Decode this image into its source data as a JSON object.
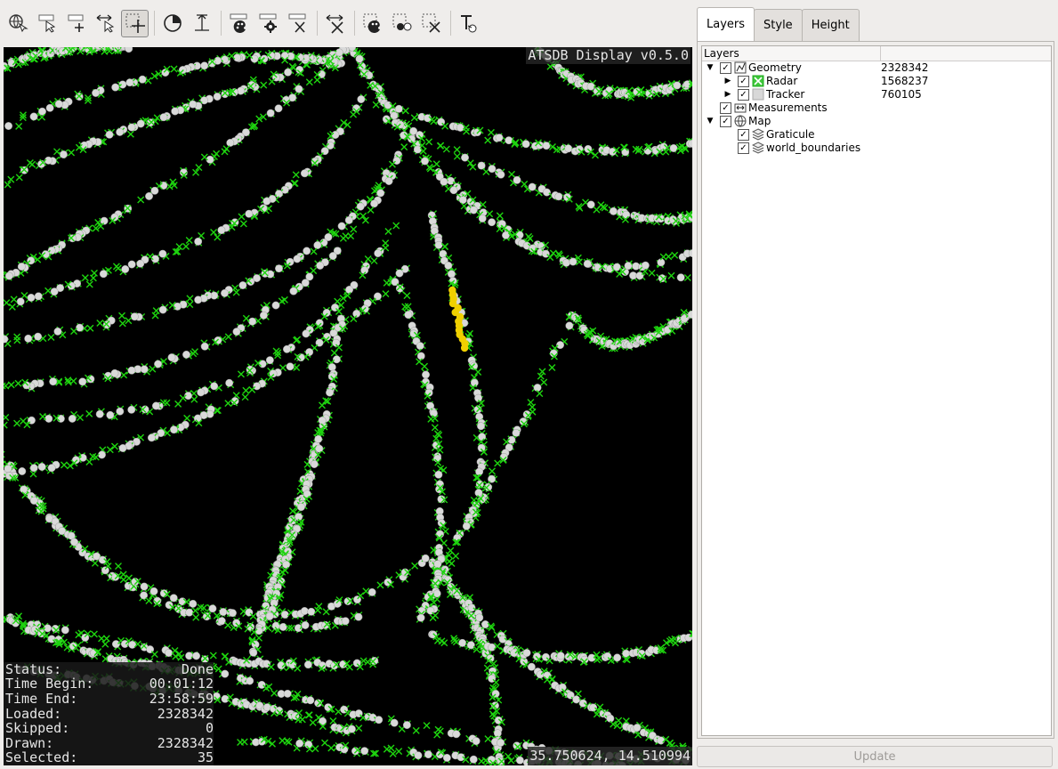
{
  "toolbar": {
    "groups": [
      [
        "globe-hand-icon",
        "select-tool-icon",
        "add-select-icon",
        "navigate-icon",
        "crosshair-select-icon"
      ],
      [
        "time-icon",
        "height-filter-icon"
      ],
      [
        "style-icon",
        "settings-icon",
        "clear-style-icon"
      ],
      [
        "deselect-icon"
      ],
      [
        "select-color-icon",
        "select-points-icon",
        "delete-selection-icon"
      ],
      [
        "text-tool-icon"
      ]
    ],
    "active": "crosshair-select-icon"
  },
  "map": {
    "title": "ATSDB Display v0.5.0",
    "coordinates": "35.750624, 14.510994",
    "background": "#000000",
    "radar_color": "#1ed40f",
    "tracker_color": "#d9d9d9",
    "selected_color": "#f0d000"
  },
  "status": {
    "rows": [
      {
        "label": "Status:",
        "value": "Done"
      },
      {
        "label": "Time Begin:",
        "value": "00:01:12"
      },
      {
        "label": "Time End:",
        "value": "23:58:59"
      },
      {
        "label": "Loaded:",
        "value": "2328342"
      },
      {
        "label": "Skipped:",
        "value": "0"
      },
      {
        "label": "Drawn:",
        "value": "2328342"
      },
      {
        "label": "Selected:",
        "value": "35"
      }
    ]
  },
  "panel": {
    "tabs": [
      "Layers",
      "Style",
      "Height"
    ],
    "active_tab": "Layers",
    "tree_header": [
      "Layers",
      ""
    ],
    "tree": [
      {
        "label": "Geometry",
        "value": "2328342",
        "depth": 0,
        "expanded": true,
        "icon": "geometry-icon",
        "checked": true
      },
      {
        "label": "Radar",
        "value": "1568237",
        "depth": 1,
        "expanded": false,
        "icon": "radar-layer-icon",
        "checked": true
      },
      {
        "label": "Tracker",
        "value": "760105",
        "depth": 1,
        "expanded": false,
        "icon": "tracker-layer-icon",
        "checked": true
      },
      {
        "label": "Measurements",
        "value": "",
        "depth": 0,
        "expanded": null,
        "icon": "measurement-icon",
        "checked": true
      },
      {
        "label": "Map",
        "value": "",
        "depth": 0,
        "expanded": true,
        "icon": "globe-icon",
        "checked": true
      },
      {
        "label": "Graticule",
        "value": "",
        "depth": 1,
        "expanded": null,
        "icon": "layers-icon",
        "checked": true
      },
      {
        "label": "world_boundaries",
        "value": "",
        "depth": 1,
        "expanded": null,
        "icon": "layers-icon",
        "checked": true
      }
    ],
    "update_label": "Update"
  }
}
